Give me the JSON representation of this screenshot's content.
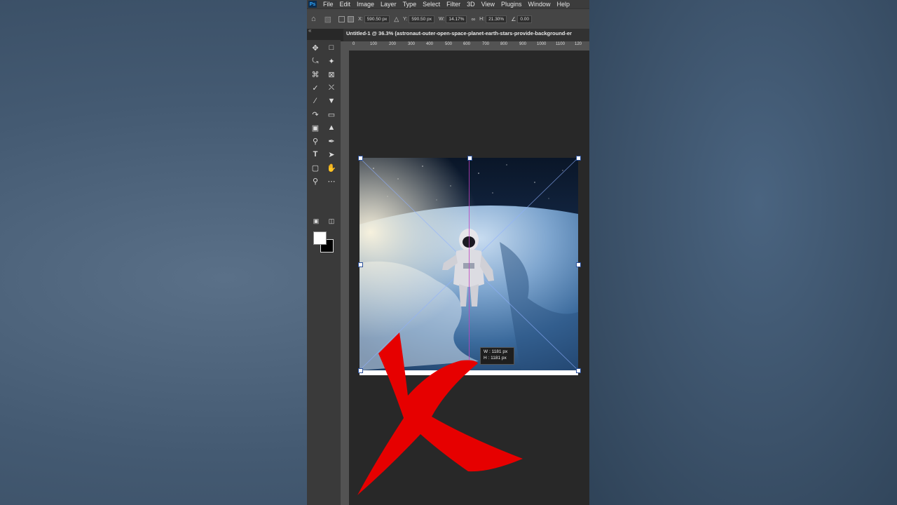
{
  "app": {
    "name": "Photoshop",
    "logo_text": "Ps"
  },
  "menu": [
    "File",
    "Edit",
    "Image",
    "Layer",
    "Type",
    "Select",
    "Filter",
    "3D",
    "View",
    "Plugins",
    "Window",
    "Help"
  ],
  "options_bar": {
    "x_label": "X:",
    "x_value": "590.50 px",
    "y_label": "Y:",
    "y_value": "590.50 px",
    "w_label": "W:",
    "w_value": "14.17%",
    "h_label": "H:",
    "h_value": "21.30%",
    "angle_value": "0.00"
  },
  "document_tab": {
    "title": "Untitled-1 @ 36.3% (astronaut-outer-open-space-planet-earth-stars-provide-background-er"
  },
  "ruler": {
    "ticks": [
      "0",
      "100",
      "200",
      "300",
      "400",
      "500",
      "600",
      "700",
      "800",
      "900",
      "1000",
      "1100",
      "120"
    ]
  },
  "toolbar": {
    "collapse_label": "«",
    "tools": [
      "move-icon",
      "marquee-icon",
      "lasso-icon",
      "quick-select-icon",
      "crop-icon",
      "frame-icon",
      "eyedropper-icon",
      "healing-brush-icon",
      "brush-icon",
      "clone-stamp-icon",
      "history-brush-icon",
      "eraser-icon",
      "gradient-icon",
      "blur-icon",
      "dodge-icon",
      "pen-icon",
      "type-icon",
      "path-select-icon",
      "rectangle-icon",
      "hand-icon",
      "zoom-icon",
      "more-tools-icon"
    ],
    "foreground_color": "#ffffff",
    "background_color": "#000000"
  },
  "transform_tooltip": {
    "w_label": "W :",
    "w_value": "1181 px",
    "h_label": "H :",
    "h_value": "1181 px"
  },
  "colors": {
    "guide": "#c040c0",
    "red_x": "#e60000"
  }
}
